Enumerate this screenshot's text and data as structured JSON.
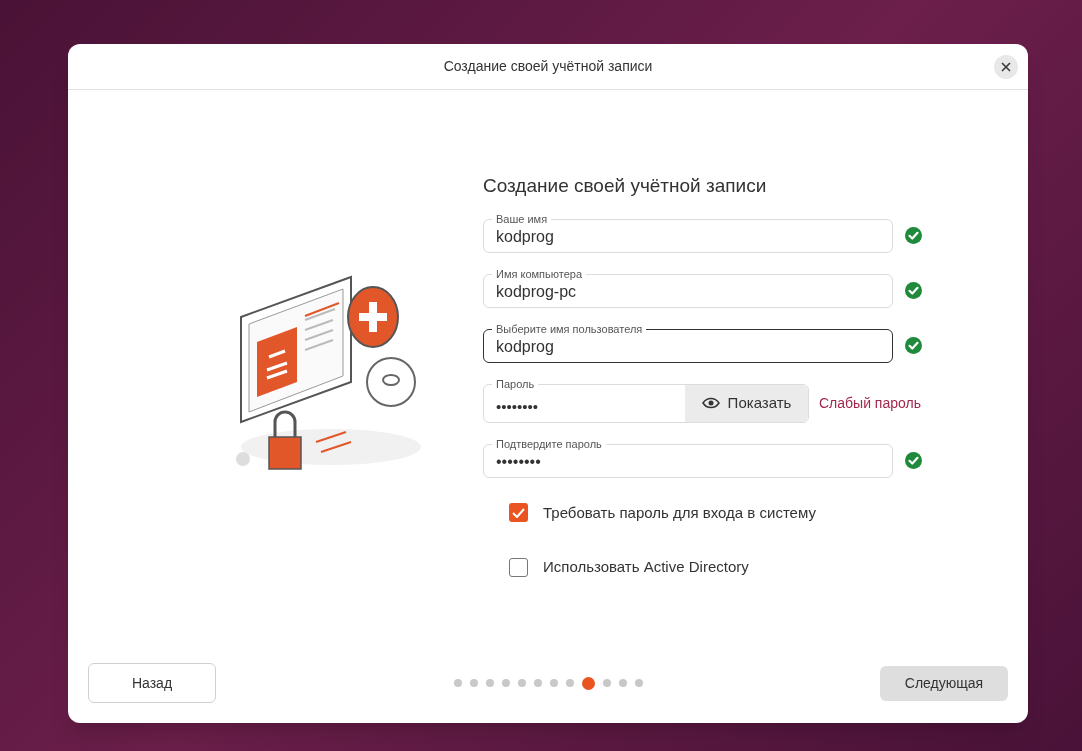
{
  "window": {
    "title": "Создание своей учётной записи"
  },
  "heading": "Создание своей учётной записи",
  "fields": [
    {
      "kind": "text",
      "label": "Ваше имя",
      "value": "kodprog",
      "valid": true,
      "focused": false
    },
    {
      "kind": "text",
      "label": "Имя компьютера",
      "value": "kodprog-pc",
      "valid": true,
      "focused": false
    },
    {
      "kind": "text",
      "label": "Выберите имя пользователя",
      "value": "kodprog",
      "valid": true,
      "focused": true
    },
    {
      "kind": "password",
      "label": "Пароль",
      "value": "••••••••",
      "show_button": "Показать",
      "strength": "Слабый пароль",
      "focused": false
    },
    {
      "kind": "text",
      "label": "Подтвердите пароль",
      "value": "••••••••",
      "valid": true,
      "focused": false
    }
  ],
  "checkboxes": [
    {
      "label": "Требовать пароль для входа в систему",
      "checked": true
    },
    {
      "label": "Использовать Active Directory",
      "checked": false
    }
  ],
  "steps": [
    {
      "selected": false
    },
    {
      "selected": false
    },
    {
      "selected": false
    },
    {
      "selected": false
    },
    {
      "selected": false
    },
    {
      "selected": false
    },
    {
      "selected": false
    },
    {
      "selected": false
    },
    {
      "selected": true
    },
    {
      "selected": false
    },
    {
      "selected": false
    },
    {
      "selected": false
    }
  ],
  "buttons": {
    "back": "Назад",
    "next": "Следующая"
  }
}
